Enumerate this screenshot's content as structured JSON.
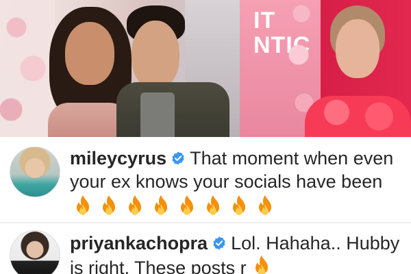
{
  "photos": {
    "left": {
      "subject": "couple-photo"
    },
    "right": {
      "sign_text": "IT\nNTIC"
    }
  },
  "comments": [
    {
      "username": "mileycyrus",
      "verified": true,
      "text_line1": "That moment when even",
      "text_line2": "your ex knows your socials have been",
      "emoji": "fire",
      "emoji_count": 8
    },
    {
      "username": "priyankachopra",
      "verified": true,
      "text_line1": "Lol. Hahaha.. Hubby",
      "text_line2": "is right. These posts r",
      "emoji": "fire",
      "emoji_count": 1
    }
  ],
  "colors": {
    "verified_badge": "#3897f0",
    "fire_outer": "#f4900c",
    "fire_inner": "#ffcc4d",
    "text": "#262626"
  }
}
